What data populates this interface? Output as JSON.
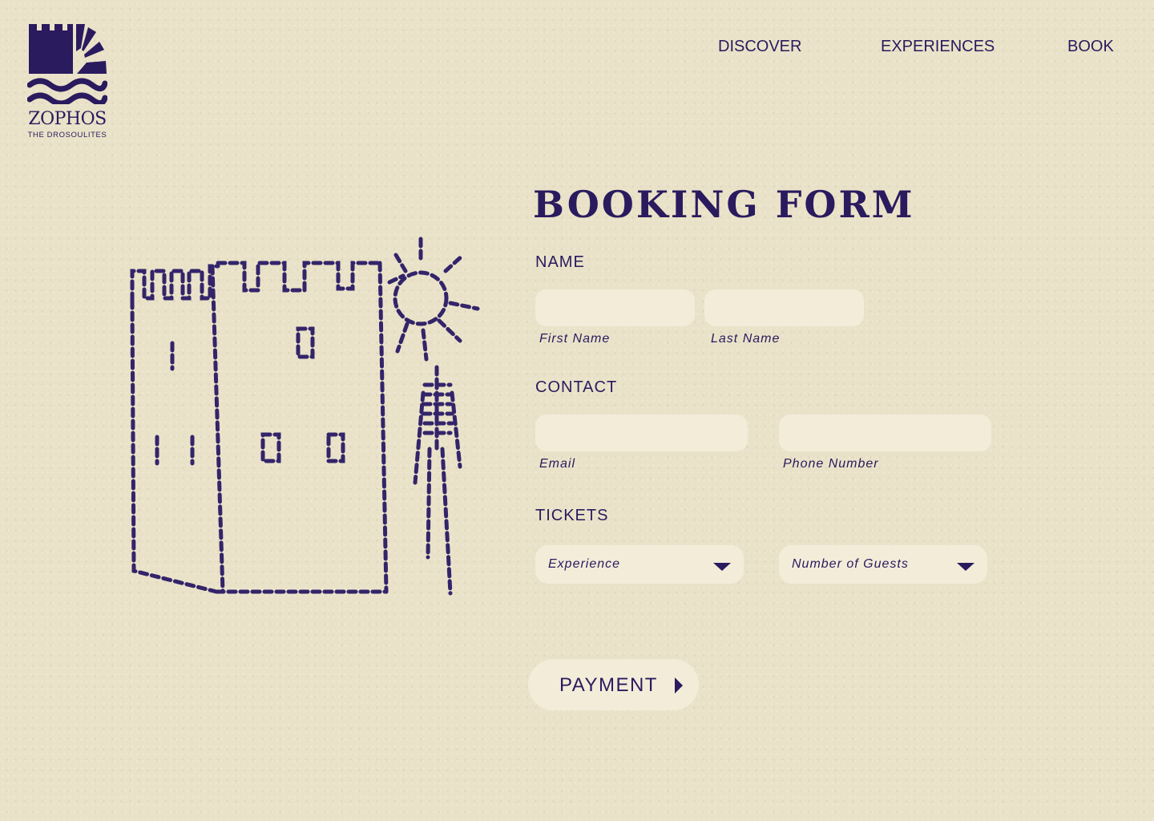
{
  "brand": {
    "name": "ZOPHOS",
    "tagline": "THE DROSOULITES",
    "color": "#2a1a5e"
  },
  "nav": {
    "items": [
      "DISCOVER",
      "EXPERIENCES",
      "BOOK"
    ]
  },
  "form": {
    "title": "BOOKING FORM",
    "sections": {
      "name": {
        "label": "NAME",
        "first_name_caption": "First Name",
        "first_name_value": "",
        "last_name_caption": "Last Name",
        "last_name_value": ""
      },
      "contact": {
        "label": "CONTACT",
        "email_caption": "Email",
        "email_value": "",
        "phone_caption": "Phone Number",
        "phone_value": ""
      },
      "tickets": {
        "label": "TICKETS",
        "experience_selected": "Experience",
        "guests_selected": "Number of Guests"
      }
    },
    "submit_label": "PAYMENT"
  },
  "icons": {
    "logo": "castle-waves-logo-icon",
    "select_caret": "caret-down-icon",
    "payment_arrow": "caret-right-icon",
    "illustration": "stitched-castle-sun-skeleton-illustration"
  },
  "colors": {
    "background": "#e9e2c8",
    "field": "#f3ecd9",
    "accent": "#2a1a5e"
  }
}
